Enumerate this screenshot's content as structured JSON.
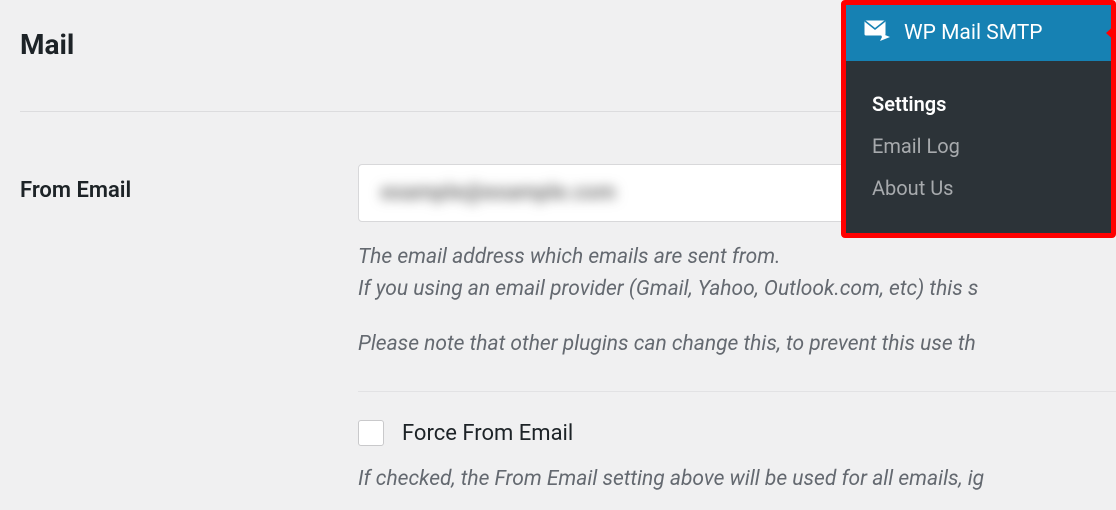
{
  "section": {
    "title": "Mail"
  },
  "from_email": {
    "label": "From Email",
    "value": "example@example.com",
    "help1": "The email address which emails are sent from.",
    "help2": "If you using an email provider (Gmail, Yahoo, Outlook.com, etc) this s",
    "help3": "Please note that other plugins can change this, to prevent this use th"
  },
  "force": {
    "label": "Force From Email",
    "help": "If checked, the From Email setting above will be used for all emails, ig"
  },
  "menu": {
    "title": "WP Mail SMTP",
    "items": [
      {
        "label": "Settings",
        "active": true
      },
      {
        "label": "Email Log",
        "active": false
      },
      {
        "label": "About Us",
        "active": false
      }
    ]
  }
}
